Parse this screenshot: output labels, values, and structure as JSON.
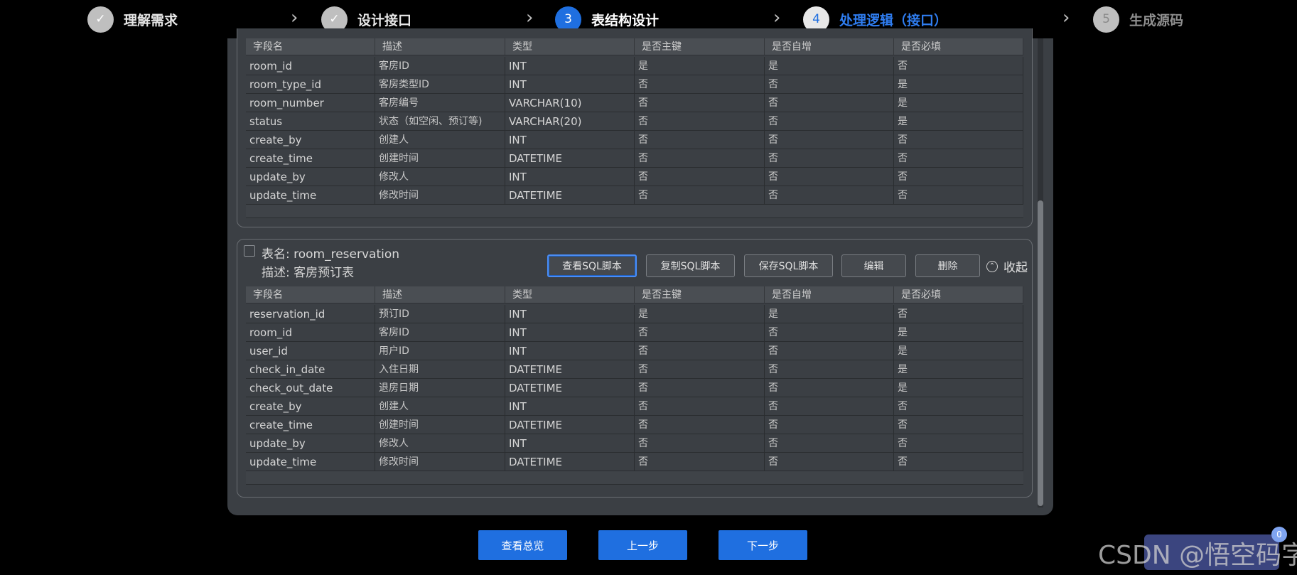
{
  "steps": [
    {
      "number": "✓",
      "label": "理解需求",
      "state": "done"
    },
    {
      "number": "✓",
      "label": "设计接口",
      "state": "done"
    },
    {
      "number": "3",
      "label": "表结构设计",
      "state": "current"
    },
    {
      "number": "4",
      "label": "处理逻辑（接口）",
      "state": "next"
    },
    {
      "number": "5",
      "label": "生成源码",
      "state": "future"
    }
  ],
  "columns": [
    "字段名",
    "描述",
    "类型",
    "是否主键",
    "是否自增",
    "是否必填"
  ],
  "table1": {
    "rows": [
      [
        "room_id",
        "客房ID",
        "INT",
        "是",
        "是",
        "否"
      ],
      [
        "room_type_id",
        "客房类型ID",
        "INT",
        "否",
        "否",
        "是"
      ],
      [
        "room_number",
        "客房编号",
        "VARCHAR(10)",
        "否",
        "否",
        "是"
      ],
      [
        "status",
        "状态（如空闲、预订等)",
        "VARCHAR(20)",
        "否",
        "否",
        "是"
      ],
      [
        "create_by",
        "创建人",
        "INT",
        "否",
        "否",
        "否"
      ],
      [
        "create_time",
        "创建时间",
        "DATETIME",
        "否",
        "否",
        "否"
      ],
      [
        "update_by",
        "修改人",
        "INT",
        "否",
        "否",
        "否"
      ],
      [
        "update_time",
        "修改时间",
        "DATETIME",
        "否",
        "否",
        "否"
      ]
    ]
  },
  "table2": {
    "name_label": "表名: room_reservation",
    "desc_label": "描述: 客房预订表",
    "buttons": [
      "查看SQL脚本",
      "复制SQL脚本",
      "保存SQL脚本",
      "编辑",
      "删除"
    ],
    "collapse_label": "收起",
    "rows": [
      [
        "reservation_id",
        "预订ID",
        "INT",
        "是",
        "是",
        "否"
      ],
      [
        "room_id",
        "客房ID",
        "INT",
        "否",
        "否",
        "是"
      ],
      [
        "user_id",
        "用户ID",
        "INT",
        "否",
        "否",
        "是"
      ],
      [
        "check_in_date",
        "入住日期",
        "DATETIME",
        "否",
        "否",
        "是"
      ],
      [
        "check_out_date",
        "退房日期",
        "DATETIME",
        "否",
        "否",
        "是"
      ],
      [
        "create_by",
        "创建人",
        "INT",
        "否",
        "否",
        "否"
      ],
      [
        "create_time",
        "创建时间",
        "DATETIME",
        "否",
        "否",
        "否"
      ],
      [
        "update_by",
        "修改人",
        "INT",
        "否",
        "否",
        "否"
      ],
      [
        "update_time",
        "修改时间",
        "DATETIME",
        "否",
        "否",
        "否"
      ]
    ]
  },
  "footer_buttons": [
    "查看总览",
    "上一步",
    "下一步"
  ],
  "watermark": "CSDN @悟空码字",
  "badge": "0",
  "colors": {
    "accent": "#1f6fe0",
    "panel": "#3b3f44",
    "background": "#000000"
  }
}
